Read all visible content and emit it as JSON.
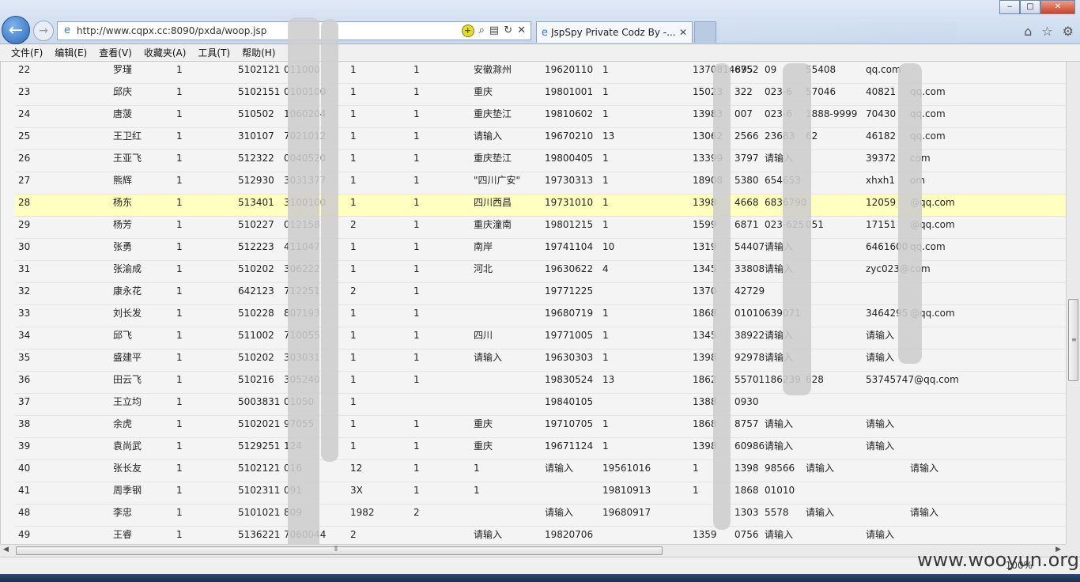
{
  "browser": {
    "url": "http://www.cqpx.cc:8090/pxda/woop.jsp",
    "tab_label": "JspSpy Private Codz By -...",
    "zoom": "100%"
  },
  "menu": [
    "文件(F)",
    "编辑(E)",
    "查看(V)",
    "收藏夹(A)",
    "工具(T)",
    "帮助(H)"
  ],
  "table": {
    "highlight_row": "28",
    "rows": [
      [
        "22",
        "罗瑾",
        "1",
        "5102121",
        "011000",
        "1",
        "1",
        "安徽滁州",
        "19620110",
        "1",
        "1370814895",
        "6752",
        "09",
        "55408",
        "qq.com"
      ],
      [
        "23",
        "邱庆",
        "1",
        "5102151",
        "0100100",
        "1",
        "1",
        "重庆",
        "19801001",
        "1",
        "15023",
        "322",
        "023-6",
        "57046",
        "40821",
        "qq.com"
      ],
      [
        "24",
        "唐菠",
        "1",
        "510502",
        "1060204",
        "1",
        "1",
        "重庆垫江",
        "19810602",
        "1",
        "13983",
        "007",
        "023-6",
        "1888-9999",
        "70430",
        "qq.com"
      ],
      [
        "25",
        "王卫红",
        "1",
        "310107",
        "7021012",
        "1",
        "1",
        "请输入",
        "19670210",
        "13",
        "13062",
        "2566",
        "23683",
        "62",
        "46182",
        "qq.com"
      ],
      [
        "26",
        "王亚飞",
        "1",
        "512322",
        "0040520",
        "1",
        "1",
        "重庆垫江",
        "19800405",
        "1",
        "13399",
        "3797",
        "请输入",
        "",
        "39372",
        "com"
      ],
      [
        "27",
        "熊辉",
        "1",
        "512930",
        "3031377",
        "1",
        "1",
        "\"四川广安\"",
        "19730313",
        "1",
        "18908",
        "5380",
        "654653",
        "",
        "xhxh1",
        "om"
      ],
      [
        "28",
        "杨东",
        "1",
        "513401",
        "3100100",
        "1",
        "1",
        "四川西昌",
        "19731010",
        "1",
        "1398",
        "4668",
        "6836790",
        "",
        "12059",
        "@qq.com"
      ],
      [
        "29",
        "杨芳",
        "1",
        "510227",
        "012158",
        "2",
        "1",
        "重庆潼南",
        "19801215",
        "1",
        "1599",
        "6871",
        "023-625",
        "051",
        "17151",
        "@qq.com"
      ],
      [
        "30",
        "张勇",
        "1",
        "512223",
        "411047",
        "1",
        "1",
        "南岸",
        "19741104",
        "10",
        "1319",
        "54407",
        "请输入",
        "",
        "6461600",
        "qq.com"
      ],
      [
        "31",
        "张渝成",
        "1",
        "510202",
        "306222",
        "1",
        "1",
        "河北",
        "19630622",
        "4",
        "1345",
        "33808",
        "请输入",
        "",
        "zyc023@",
        "com"
      ],
      [
        "32",
        "康永花",
        "1",
        "642123",
        "712251",
        "2",
        "1",
        "",
        "19771225",
        "",
        "1370",
        "42729",
        "",
        "",
        "",
        ""
      ],
      [
        "33",
        "刘长发",
        "1",
        "510228",
        "807193",
        "1",
        "1",
        "",
        "19680719",
        "1",
        "1868",
        "01010",
        "639071",
        "",
        "3464295",
        "@qq.com"
      ],
      [
        "34",
        "邱飞",
        "1",
        "511002",
        "710055",
        "1",
        "1",
        "四川",
        "19771005",
        "1",
        "1345",
        "38922",
        "请输入",
        "",
        "请输入",
        ""
      ],
      [
        "35",
        "盛建平",
        "1",
        "510202",
        "303031",
        "1",
        "1",
        "请输入",
        "19630303",
        "1",
        "1398",
        "92978",
        "请输入",
        "",
        "请输入",
        ""
      ],
      [
        "36",
        "田云飞",
        "1",
        "510216",
        "305240",
        "1",
        "1",
        "",
        "19830524",
        "13",
        "1862",
        "55701",
        "186239",
        "628",
        "53745747@qq.com",
        ""
      ],
      [
        "37",
        "王立均",
        "1",
        "5003831",
        "01050",
        "1",
        "",
        "",
        "19840105",
        "",
        "1388",
        "0930",
        "",
        "",
        "",
        ""
      ],
      [
        "38",
        "余虎",
        "1",
        "5102021",
        "97055",
        "1",
        "1",
        "重庆",
        "19710705",
        "1",
        "1868",
        "8757",
        "请输入",
        "",
        "请输入",
        ""
      ],
      [
        "39",
        "袁尚武",
        "1",
        "5129251",
        "124",
        "1",
        "1",
        "重庆",
        "19671124",
        "1",
        "1398",
        "60986",
        "请输入",
        "",
        "请输入",
        ""
      ],
      [
        "40",
        "张长友",
        "1",
        "5102121",
        "016",
        "12",
        "1",
        "1",
        "请输入",
        "19561016",
        "1",
        "1398",
        "98566",
        "请输入",
        "",
        "请输入",
        ""
      ],
      [
        "41",
        "周季钢",
        "1",
        "5102311",
        "091",
        "3X",
        "1",
        "1",
        "",
        "19810913",
        "1",
        "1868",
        "01010",
        "",
        "",
        ""
      ],
      [
        "48",
        "李忠",
        "1",
        "5101021",
        "809",
        "1982",
        "2",
        "",
        "请输入",
        "19680917",
        "",
        "1303",
        "5578",
        "请输入",
        "",
        "请输入"
      ],
      [
        "49",
        "王睿",
        "1",
        "5136221",
        "7060044",
        "2",
        "",
        "请输入",
        "19820706",
        "",
        "1359",
        "0756",
        "请输入",
        "",
        "请输入",
        ""
      ]
    ]
  },
  "watermark": "www.wooyun.org"
}
